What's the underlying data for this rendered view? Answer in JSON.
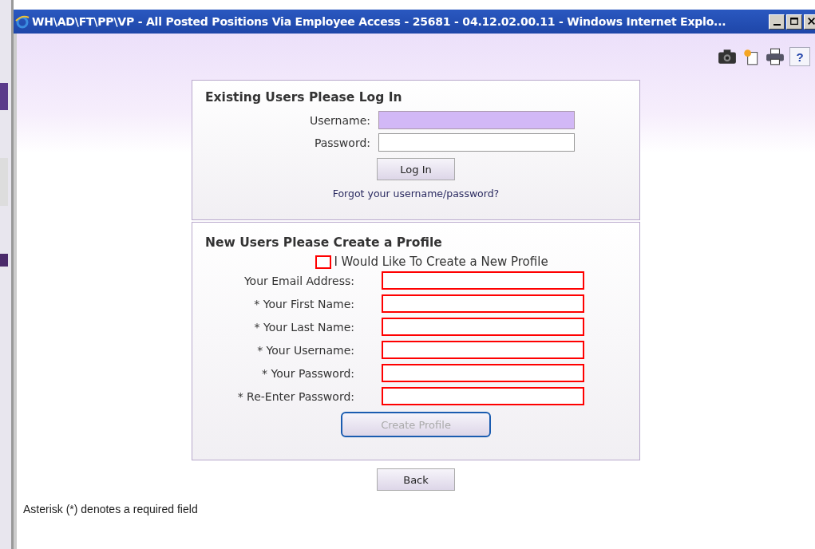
{
  "window": {
    "title": "WH\\AD\\FT\\PP\\VP - All Posted Positions Via Employee Access - 25681 - 04.12.02.00.11 - Windows Internet Explo..."
  },
  "toolbar": {
    "help_label": "?"
  },
  "login": {
    "heading": "Existing Users Please Log In",
    "fields": [
      {
        "label": "Username:",
        "focused": true
      },
      {
        "label": "Password:",
        "focused": false
      }
    ],
    "button": "Log In",
    "link": "Forgot your username/password?"
  },
  "profile": {
    "heading": "New Users Please Create a Profile",
    "checkbox": {
      "label": "I Would Like To Create a New Profile",
      "checked": false,
      "error": true
    },
    "fields": [
      {
        "label": "Your Email Address:",
        "error": true
      },
      {
        "label": "* Your First Name:",
        "error": true
      },
      {
        "label": "* Your Last Name:",
        "error": true
      },
      {
        "label": "* Your Username:",
        "error": true
      },
      {
        "label": "* Your Password:",
        "error": true
      },
      {
        "label": "* Re-Enter Password:",
        "error": true
      }
    ],
    "button": {
      "label": "Create Profile",
      "disabled": true,
      "focused": true
    }
  },
  "back_button": "Back",
  "footnote": "Asterisk (*) denotes a required field"
}
